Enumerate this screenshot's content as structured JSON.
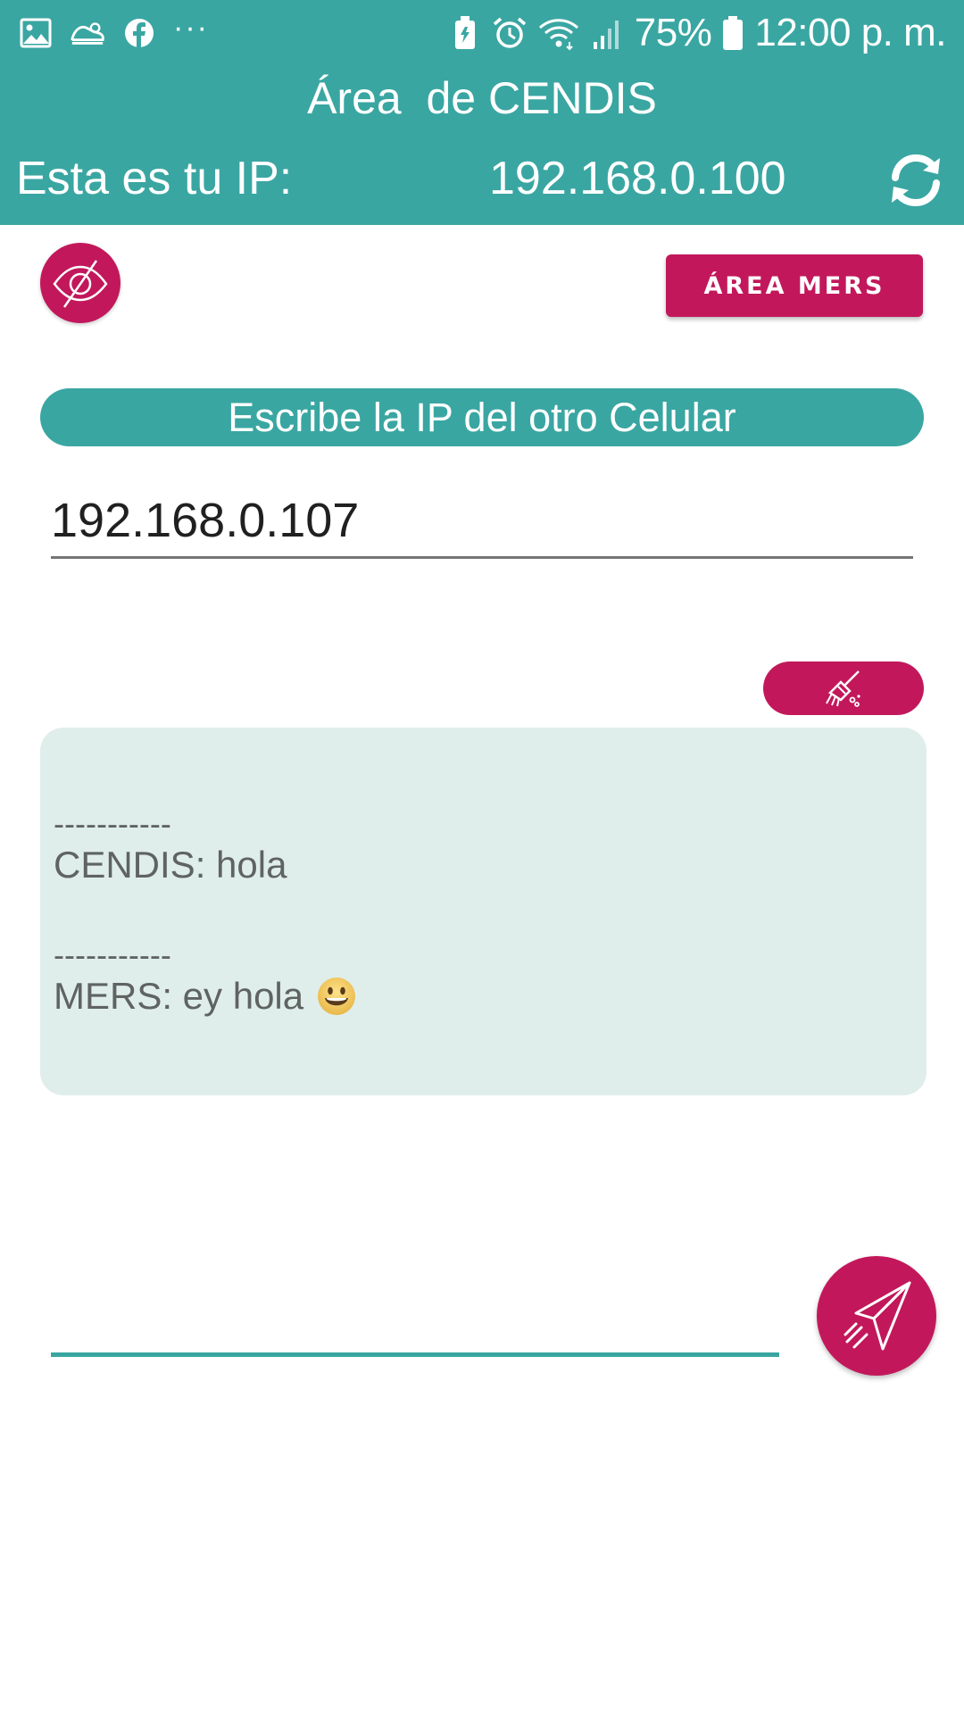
{
  "status_bar": {
    "left_icons": [
      "gallery-icon",
      "shoe-icon",
      "facebook-icon"
    ],
    "more": "···",
    "right_icons": [
      "battery-saver-icon",
      "alarm-icon",
      "wifi-icon",
      "signal-icon"
    ],
    "battery": "75%",
    "time": "12:00 p. m."
  },
  "header": {
    "title": "Área  de CENDIS",
    "ip_label": "Esta es tu IP:",
    "ip_value": "192.168.0.100"
  },
  "toolbar": {
    "area_button": "ÁREA MERS"
  },
  "ip_prompt": {
    "label": "Escribe la IP del otro Celular",
    "value": "192.168.0.107"
  },
  "chat": {
    "messages": [
      {
        "separator": "-----------",
        "text": "CENDIS: hola"
      },
      {
        "separator": "-----------",
        "text": "MERS: ey hola",
        "emoji": "grinning-face"
      }
    ]
  },
  "compose": {
    "value": ""
  },
  "colors": {
    "teal": "#3aa6a2",
    "magenta": "#c2185b",
    "chat_background": "#dfeeea"
  }
}
